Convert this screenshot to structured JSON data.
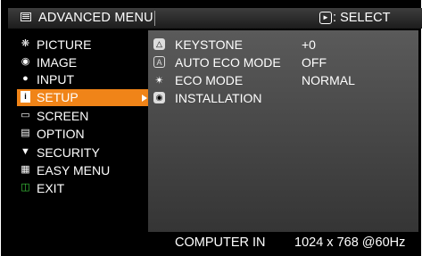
{
  "title": "ADVANCED MENU",
  "select_hint": "SELECT",
  "left_menu": [
    {
      "label": "PICTURE",
      "icon": "picture-icon"
    },
    {
      "label": "IMAGE",
      "icon": "image-icon"
    },
    {
      "label": "INPUT",
      "icon": "input-icon"
    },
    {
      "label": "SETUP",
      "icon": "setup-icon",
      "selected": true
    },
    {
      "label": "SCREEN",
      "icon": "screen-icon"
    },
    {
      "label": "OPTION",
      "icon": "option-icon"
    },
    {
      "label": "SECURITY",
      "icon": "security-icon"
    },
    {
      "label": "EASY MENU",
      "icon": "easy-menu-icon"
    },
    {
      "label": "EXIT",
      "icon": "exit-icon"
    }
  ],
  "setup_items": [
    {
      "label": "KEYSTONE",
      "value": "+0",
      "icon": "keystone-icon"
    },
    {
      "label": "AUTO ECO MODE",
      "value": "OFF",
      "icon": "auto-eco-icon"
    },
    {
      "label": "ECO MODE",
      "value": "NORMAL",
      "icon": "eco-mode-icon"
    },
    {
      "label": "INSTALLATION",
      "value": "",
      "icon": "installation-icon"
    }
  ],
  "status": {
    "source": "COMPUTER IN",
    "signal": "1024 x 768 @60Hz"
  }
}
